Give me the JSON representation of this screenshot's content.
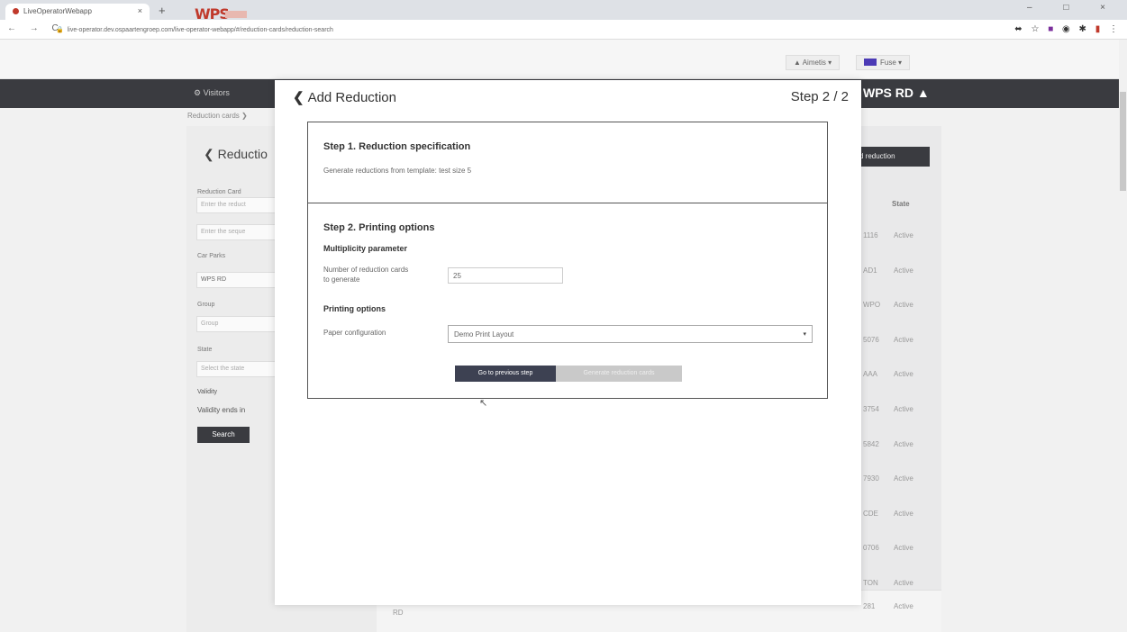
{
  "browser": {
    "tab_title": "LiveOperatorWebapp",
    "tab_close": "×",
    "new_tab": "+",
    "window_controls": "–  □  ×",
    "nav_buttons": "←  →  C",
    "url": "live-operator.dev.ospaartengroep.com/live-operator-webapp/#/reduction-cards/reduction-search",
    "extensions": [
      "⬌",
      "☆",
      "■",
      "◉",
      "✱",
      "▮",
      "⋮"
    ]
  },
  "header": {
    "logo": "WPS",
    "user": "▲ Aimetis ▾",
    "language": "Fuse ▾"
  },
  "navbar": {
    "visitors": "⚙ Visitors",
    "brand": "WPS RD ▲"
  },
  "breadcrumb": "Reduction cards ❯",
  "filter": {
    "title": "❮  Reductio",
    "reduction_card_label": "Reduction Card",
    "reduction_card_placeholder": "Enter the reduct",
    "sequence_placeholder": "Enter the seque",
    "car_parks_label": "Car Parks",
    "car_parks_value": "WPS RD",
    "group_label": "Group",
    "group_placeholder": "Group",
    "state_label": "State",
    "state_placeholder": "Select the state",
    "validity_label": "Validity",
    "validity_value": "Validity ends in",
    "search_button": "Search"
  },
  "results": {
    "add_button": "d reduction",
    "state_header": "State",
    "rows": [
      {
        "code": "1116",
        "state": "Active"
      },
      {
        "code": "AD1",
        "state": "Active"
      },
      {
        "code": "WPO",
        "state": "Active"
      },
      {
        "code": "5076",
        "state": "Active"
      },
      {
        "code": "AAA",
        "state": "Active"
      },
      {
        "code": "3754",
        "state": "Active"
      },
      {
        "code": "5842",
        "state": "Active"
      },
      {
        "code": "7930",
        "state": "Active"
      },
      {
        "code": "CDE",
        "state": "Active"
      },
      {
        "code": "0706",
        "state": "Active"
      },
      {
        "code": "TON",
        "state": "Active"
      },
      {
        "code": "281",
        "state": "Active"
      }
    ],
    "bottom_label": "RD"
  },
  "modal": {
    "title": "Add Reduction",
    "back_chevron": "❮",
    "step_indicator": "Step 2 / 2",
    "step1_title": "Step 1. Reduction specification",
    "step1_text": "Generate reductions from template: test size 5",
    "step2_title": "Step 2. Printing options",
    "multiplicity_title": "Multiplicity parameter",
    "number_label": "Number of reduction cards to generate",
    "number_value": "25",
    "printing_title": "Printing options",
    "paper_label": "Paper configuration",
    "paper_value": "Demo Print Layout",
    "select_arrow": "▾",
    "prev_button": "Go to previous step",
    "generate_button": "Generate reduction cards"
  }
}
